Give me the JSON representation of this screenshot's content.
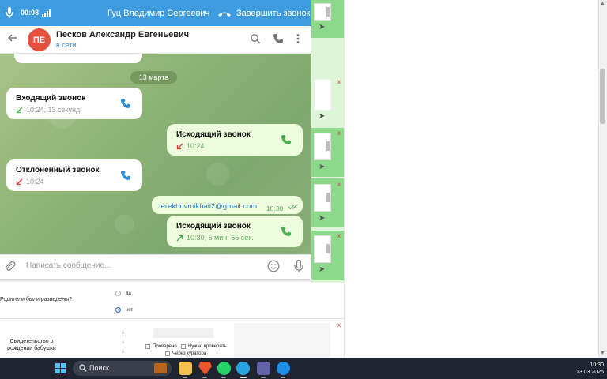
{
  "call_bar": {
    "timer": "00:08",
    "caller_name": "Гуц Владимир Сергеевич",
    "end_call_label": "Завершить звонок"
  },
  "chat_header": {
    "avatar_initials": "ПЕ",
    "contact_name": "Песков Александр Евгеньевич",
    "status": "в сети"
  },
  "chat": {
    "date_separator": "13 марта",
    "messages": [
      {
        "type": "call",
        "direction": "incoming",
        "title": "Входящий звонок",
        "meta": "10:24, 13 секунд"
      },
      {
        "type": "call",
        "direction": "outgoing",
        "title": "Исходящий звонок",
        "meta": "10:24"
      },
      {
        "type": "call",
        "direction": "declined",
        "title": "Отклонённый звонок",
        "meta": "10:24"
      },
      {
        "type": "text",
        "direction": "outgoing",
        "text": "terekhovmikhail2@gmail.com",
        "time": "10:30"
      },
      {
        "type": "call",
        "direction": "outgoing",
        "title": "Исходящий звонок",
        "meta": "10:30, 5 мин. 55 сек."
      }
    ]
  },
  "composer": {
    "placeholder": "Написать сообщение..."
  },
  "background_form": {
    "question": "Родители были разведены?",
    "options": [
      {
        "label": "да",
        "selected": false
      },
      {
        "label": "нет",
        "selected": true
      }
    ],
    "document_label": "Свидетельство о рождении бабушки",
    "checkboxes": [
      "Проверено",
      "Нужно проверить",
      "Через куратора"
    ],
    "delete_mark": "x"
  },
  "taskbar": {
    "search_label": "Поиск",
    "time": "10:30",
    "date": "13.03.2025",
    "apps": [
      "file-explorer",
      "brave-browser",
      "whatsapp",
      "telegram",
      "teams",
      "edge-app"
    ]
  },
  "colors": {
    "call_bar": "#3e9be0",
    "avatar": "#e3513e",
    "accent_blue": "#3a8fd9",
    "outgoing_bubble": "#eefdde",
    "call_green": "#4caf50",
    "call_red": "#e53935"
  }
}
